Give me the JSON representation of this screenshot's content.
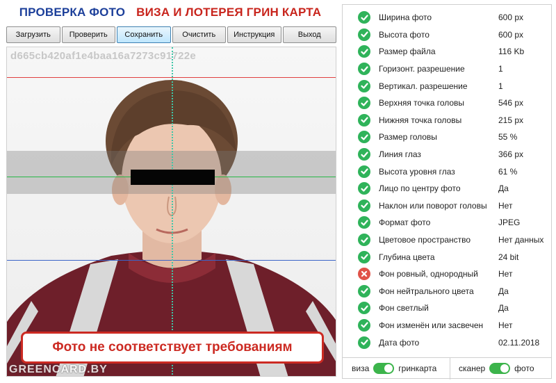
{
  "header": {
    "title_left": "ПРОВЕРКА ФОТО",
    "title_right": "ВИЗА И ЛОТЕРЕЯ ГРИН КАРТА"
  },
  "toolbar": {
    "load": "Загрузить",
    "check": "Проверить",
    "save": "Сохранить",
    "clear": "Очистить",
    "instructions": "Инструкция",
    "exit": "Выход"
  },
  "photo": {
    "hash": "d665cb420af1e4baa16a7273c91722e",
    "verdict": "Фото не соответствует требованиям",
    "watermark": "GREENCARD.BY"
  },
  "checks": [
    {
      "label": "Ширина фото",
      "value": "600 px",
      "status": "ok"
    },
    {
      "label": "Высота фото",
      "value": "600 px",
      "status": "ok"
    },
    {
      "label": "Размер файла",
      "value": "116 Kb",
      "status": "ok"
    },
    {
      "label": "Горизонт. разрешение",
      "value": "1",
      "status": "ok"
    },
    {
      "label": "Вертикал. разрешение",
      "value": "1",
      "status": "ok"
    },
    {
      "label": "Верхняя точка головы",
      "value": "546 px",
      "status": "ok"
    },
    {
      "label": "Нижняя точка головы",
      "value": "215 px",
      "status": "ok"
    },
    {
      "label": "Размер головы",
      "value": "55 %",
      "status": "ok"
    },
    {
      "label": "Линия глаз",
      "value": "366 px",
      "status": "ok"
    },
    {
      "label": "Высота уровня глаз",
      "value": "61 %",
      "status": "ok"
    },
    {
      "label": "Лицо по центру фото",
      "value": "Да",
      "status": "ok"
    },
    {
      "label": "Наклон или поворот головы",
      "value": "Нет",
      "status": "ok"
    },
    {
      "label": "Формат фото",
      "value": "JPEG",
      "status": "ok"
    },
    {
      "label": "Цветовое пространство",
      "value": "Нет данных",
      "status": "ok"
    },
    {
      "label": "Глубина цвета",
      "value": "24 bit",
      "status": "ok"
    },
    {
      "label": "Фон ровный, однородный",
      "value": "Нет",
      "status": "fail"
    },
    {
      "label": "Фон нейтрального цвета",
      "value": "Да",
      "status": "ok"
    },
    {
      "label": "Фон светлый",
      "value": "Да",
      "status": "ok"
    },
    {
      "label": "Фон изменён или засвечен",
      "value": "Нет",
      "status": "ok"
    },
    {
      "label": "Дата фото",
      "value": "02.11.2018",
      "status": "ok"
    }
  ],
  "footer": {
    "mode_left": "виза",
    "mode_right": "гринкарта",
    "source_left": "сканер",
    "source_right": "фото",
    "mode_on": true,
    "source_on": true
  },
  "colors": {
    "ok": "#2fb35a",
    "fail": "#e05248",
    "title_blue": "#1c3f9a",
    "title_red": "#c8241c"
  }
}
